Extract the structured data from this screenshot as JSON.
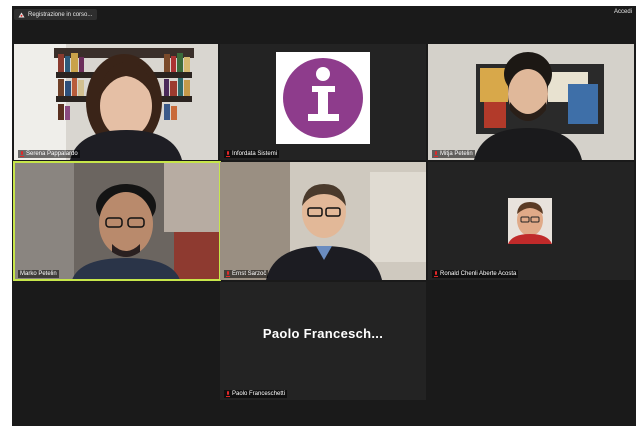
{
  "window": {
    "recording_label": "Registrazione in corso...",
    "signin_label": "Accedi"
  },
  "participants": [
    {
      "name": "Serena Pappalardo",
      "muted": true
    },
    {
      "name": "Infordata Sistemi",
      "muted": true
    },
    {
      "name": "Mitja Petelin",
      "muted": true
    },
    {
      "name": "Marko Petelin",
      "muted": false,
      "active_speaker": true
    },
    {
      "name": "Ernst Sarzoč",
      "muted": true
    },
    {
      "name": "Ronald Chenli Aberte Acosta",
      "muted": true
    },
    {
      "name": "Paolo Franceschetti",
      "muted": true,
      "display_label": "Paolo Francesch..."
    }
  ],
  "colors": {
    "app_bg": "#1a1a1a",
    "tile_bg": "#232323",
    "active_border": "#c7e64a",
    "mute_red": "#e02828",
    "logo_purple": "#8e3c8c"
  }
}
